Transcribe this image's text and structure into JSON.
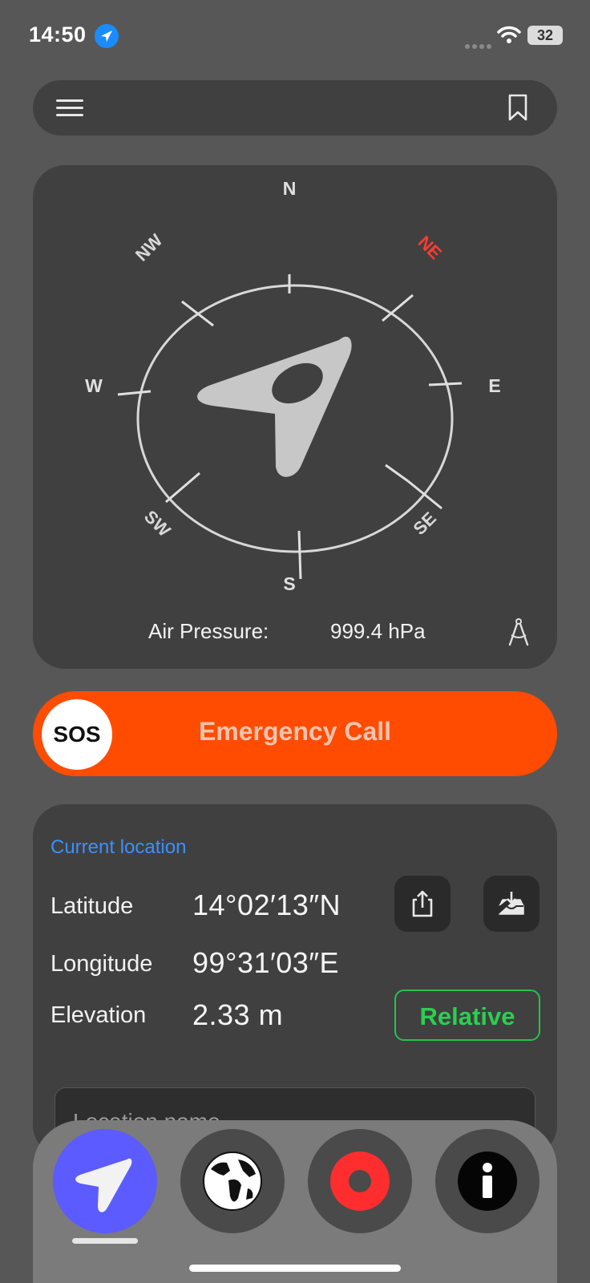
{
  "status_bar": {
    "time": "14:50",
    "battery": "32"
  },
  "compass": {
    "directions": {
      "n": "N",
      "ne": "NE",
      "e": "E",
      "se": "SE",
      "s": "S",
      "sw": "SW",
      "w": "W",
      "nw": "NW"
    },
    "highlight_direction": "NE",
    "highlight_color": "#ff3b30",
    "air_pressure_label": "Air Pressure:",
    "air_pressure_value": "999.4 hPa"
  },
  "sos": {
    "badge": "SOS",
    "label": "Emergency Call",
    "color": "#ff4c00"
  },
  "location": {
    "heading": "Current location",
    "latitude_label": "Latitude",
    "latitude_value": "14°02′13″N",
    "longitude_label": "Longitude",
    "longitude_value": "99°31′03″E",
    "elevation_label": "Elevation",
    "elevation_value": "2.33 m",
    "relative_button": "Relative",
    "name_placeholder": "Location name"
  },
  "tabs": [
    {
      "name": "compass",
      "icon": "navigation-arrow-icon",
      "active": true
    },
    {
      "name": "map",
      "icon": "globe-icon",
      "active": false
    },
    {
      "name": "record",
      "icon": "record-icon",
      "active": false
    },
    {
      "name": "info",
      "icon": "info-icon",
      "active": false
    }
  ],
  "colors": {
    "accent": "#5b5bff",
    "green": "#2bcf50",
    "link": "#3a90ff"
  }
}
